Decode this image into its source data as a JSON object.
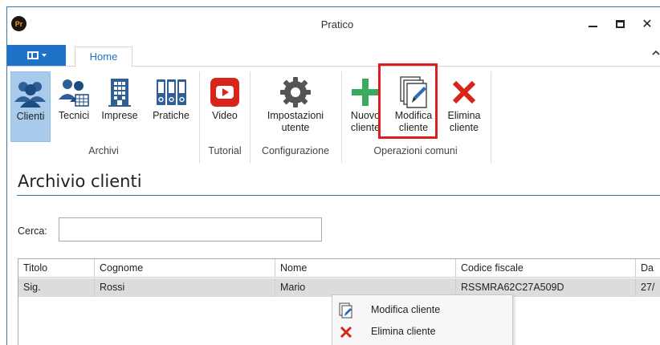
{
  "window": {
    "title": "Pratico",
    "logo_text": "Pr"
  },
  "ribbon": {
    "active_tab": "Home",
    "buttons": {
      "clienti": "Clienti",
      "tecnici": "Tecnici",
      "imprese": "Imprese",
      "pratiche": "Pratiche",
      "video": "Video",
      "impostazioni_l1": "Impostazioni",
      "impostazioni_l2": "utente",
      "nuovo_l1": "Nuovo",
      "nuovo_l2": "cliente",
      "modifica_l1": "Modifica",
      "modifica_l2": "cliente",
      "elimina_l1": "Elimina",
      "elimina_l2": "cliente"
    },
    "groups": {
      "archivi": "Archivi",
      "tutorial": "Tutorial",
      "configurazione": "Configurazione",
      "operazioni": "Operazioni comuni"
    }
  },
  "page": {
    "title": "Archivio clienti",
    "search_label": "Cerca:",
    "search_value": ""
  },
  "grid": {
    "columns": [
      "Titolo",
      "Cognome",
      "Nome",
      "Codice fiscale",
      "Da"
    ],
    "rows": [
      [
        "Sig.",
        "Rossi",
        "Mario",
        "RSSMRA62C27A509D",
        "27/"
      ]
    ]
  },
  "context_menu": {
    "items": [
      "Modifica cliente",
      "Elimina cliente"
    ]
  },
  "colors": {
    "accent": "#1e73c8",
    "selected": "#a8cbec",
    "highlight": "#e01c23",
    "add": "#3aaa5c",
    "delete": "#d9241b"
  },
  "icons": [
    "people-icon",
    "technician-icon",
    "building-icon",
    "folders-icon",
    "video-play-icon",
    "gear-icon",
    "plus-icon",
    "edit-document-icon",
    "delete-x-icon"
  ]
}
